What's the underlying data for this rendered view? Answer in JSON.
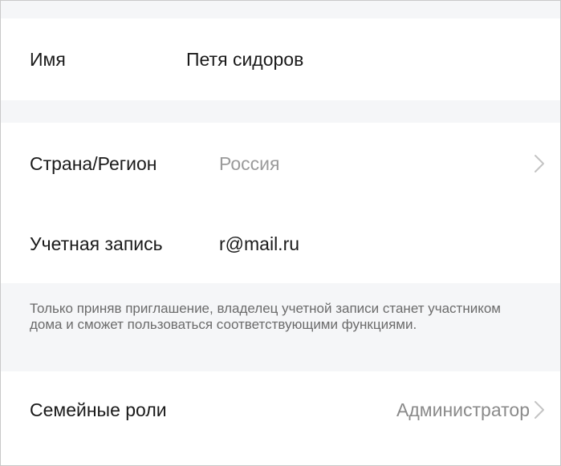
{
  "profile": {
    "name_label": "Имя",
    "name_value": "Петя сидоров"
  },
  "country": {
    "label": "Страна/Регион",
    "value": "Россия",
    "chevron_icon": "chevron-right-icon"
  },
  "account": {
    "label": "Учетная запись",
    "value": "r@mail.ru"
  },
  "info_text": "Только приняв приглашение, владелец учетной записи станет участником дома и сможет пользоваться соответствующими функциями.",
  "roles": {
    "label": "Семейные роли",
    "value": "Администратор",
    "chevron_icon": "chevron-right-icon"
  },
  "colors": {
    "section_gap": "#f5f6f8",
    "primary_text": "#1a1a1a",
    "secondary_text": "#9a9a9a",
    "hint_text": "#6b6b6b",
    "chevron": "#c4c4c4"
  }
}
